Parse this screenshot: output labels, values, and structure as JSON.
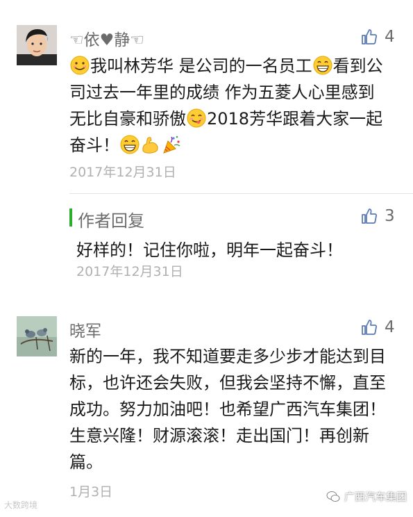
{
  "comments": [
    {
      "name": "☜依♥静☜",
      "likes": "4",
      "text_segments": [
        {
          "type": "emoji",
          "icon": "smile-emoji-icon"
        },
        {
          "type": "text",
          "value": "我叫林芳华 是公司的一名员工"
        },
        {
          "type": "emoji",
          "icon": "grin-emoji-icon"
        },
        {
          "type": "text",
          "value": "看到公司过去一年里的成绩 作为五菱人心里感到无比自豪和骄傲"
        },
        {
          "type": "emoji",
          "icon": "yum-emoji-icon"
        },
        {
          "type": "text",
          "value": "2018芳华跟着大家一起奋斗！"
        },
        {
          "type": "emoji",
          "icon": "grin-emoji-icon"
        },
        {
          "type": "emoji",
          "icon": "flexed-biceps-emoji-icon"
        },
        {
          "type": "emoji",
          "icon": "party-popper-emoji-icon"
        }
      ],
      "date": "2017年12月31日",
      "reply": {
        "title": "作者回复",
        "likes": "3",
        "text": "好样的！记住你啦，明年一起奋斗！",
        "date": "2017年12月31日"
      }
    },
    {
      "name": "晓军",
      "likes": "4",
      "text": "新的一年，我不知道要走多少步才能达到目标，也许还会失败，但我会坚持不懈，直至成功。努力加油吧！也希望广西汽车集团！生意兴隆！财源滚滚！走出国门！再创新篇。",
      "date": "1月3日"
    }
  ],
  "watermark_left": "大数跨境",
  "watermark_right": "广西汽车集团",
  "colors": {
    "accent_green": "#2aae2c",
    "meta_gray": "#6b6b6b",
    "date_gray": "#b0b0b0",
    "thumb_blue": "#5b7bb5"
  }
}
